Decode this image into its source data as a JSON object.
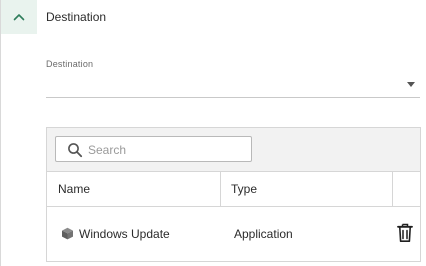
{
  "section": {
    "title": "Destination",
    "toggle_icon": "chevron-up-icon"
  },
  "destination_field": {
    "label": "Destination",
    "value": ""
  },
  "grid": {
    "search_placeholder": "Search",
    "columns": [
      "Name",
      "Type"
    ],
    "rows": [
      {
        "name": "Windows Update",
        "type": "Application",
        "icon": "cube-icon"
      }
    ],
    "row_action_icon": "trash-icon"
  },
  "colors": {
    "accent_green": "#2e7d5b",
    "toggle_bg": "#e9f3ee",
    "toolbar_bg": "#f2f2f2",
    "border": "#d6d6d6"
  }
}
